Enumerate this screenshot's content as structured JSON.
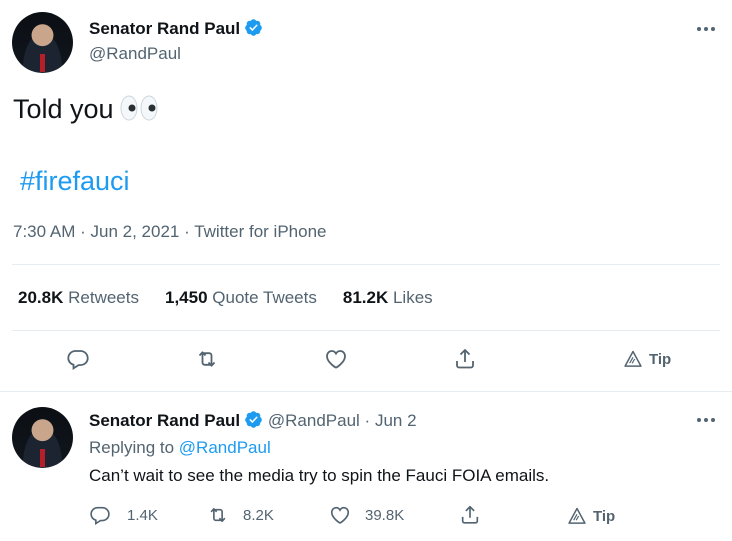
{
  "main_tweet": {
    "author": {
      "name": "Senator Rand Paul",
      "handle": "@RandPaul",
      "verified": true
    },
    "text": "Told you",
    "emoji": "eyes-emoji",
    "hashtag": "#firefauci",
    "time": "7:30 AM",
    "date": "Jun 2, 2021",
    "source": "Twitter for iPhone",
    "separator": "·",
    "stats": {
      "retweets_count": "20.8K",
      "retweets_label": "Retweets",
      "quotes_count": "1,450",
      "quotes_label": "Quote Tweets",
      "likes_count": "81.2K",
      "likes_label": "Likes"
    },
    "actions": {
      "tip_label": "Tip"
    }
  },
  "reply_tweet": {
    "author": {
      "name": "Senator Rand Paul",
      "handle": "@RandPaul",
      "verified": true
    },
    "separator": "·",
    "date": "Jun 2",
    "replying_prefix": "Replying to",
    "replying_to": "@RandPaul",
    "text": "Can’t wait to see the media try to spin the Fauci FOIA emails.",
    "actions": {
      "replies": "1.4K",
      "retweets": "8.2K",
      "likes": "39.8K",
      "tip_label": "Tip"
    }
  },
  "colors": {
    "accent": "#1d9bf0",
    "muted": "#536471",
    "text": "#0f1419",
    "divider": "#e6ecf0"
  },
  "icons": [
    "verified-badge-icon",
    "more-icon",
    "reply-icon",
    "retweet-icon",
    "like-icon",
    "share-icon",
    "tip-icon"
  ]
}
